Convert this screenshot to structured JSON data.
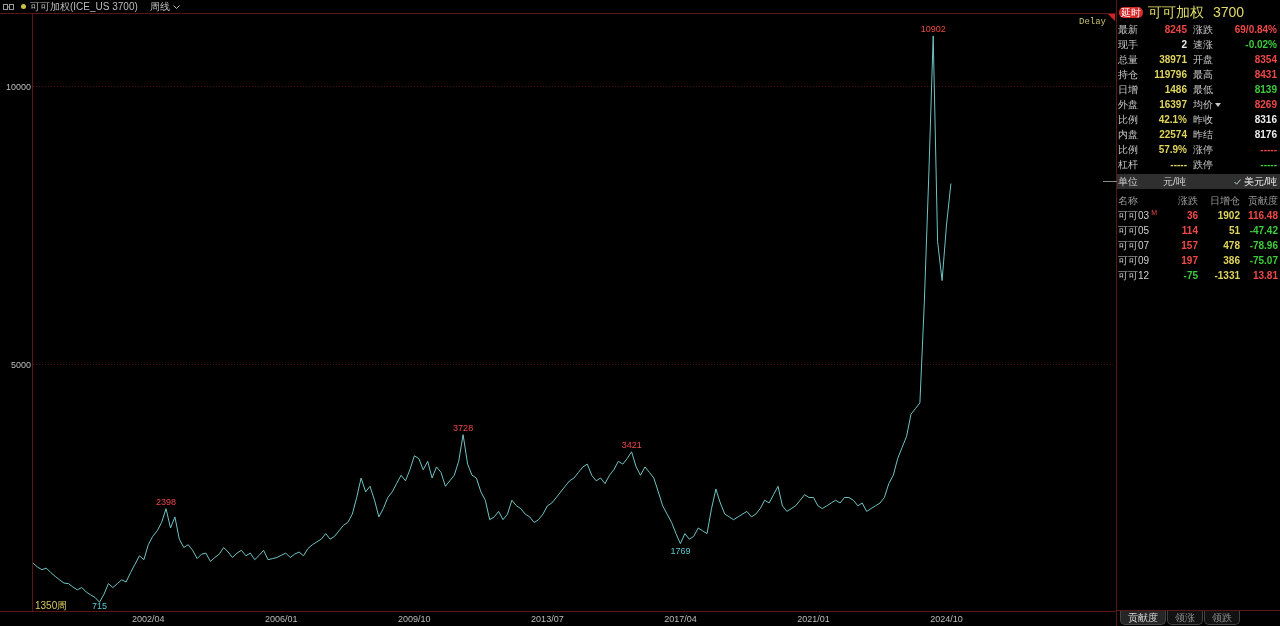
{
  "toolbar": {
    "symbol": "可可加权(ICE_US 3700)",
    "period": "周线"
  },
  "chart": {
    "delay_label": "Delay",
    "bar_count": "1350周",
    "chart_data": {
      "type": "line",
      "categories": [
        null,
        null,
        null,
        null,
        null,
        null,
        null,
        null,
        null,
        null,
        null,
        null,
        null,
        null,
        null,
        null,
        null,
        null,
        null,
        null,
        null,
        null,
        null,
        null,
        null,
        null,
        "2002/04",
        null,
        null,
        null,
        null,
        null,
        null,
        null,
        null,
        null,
        null,
        null,
        null,
        null,
        null,
        null,
        null,
        null,
        null,
        null,
        null,
        null,
        null,
        null,
        null,
        null,
        null,
        null,
        null,
        null,
        "2006/01",
        null,
        null,
        null,
        null,
        null,
        null,
        null,
        null,
        null,
        null,
        null,
        null,
        null,
        null,
        null,
        null,
        null,
        null,
        null,
        null,
        null,
        null,
        null,
        null,
        null,
        null,
        null,
        null,
        null,
        "2009/10",
        null,
        null,
        null,
        null,
        null,
        null,
        null,
        null,
        null,
        null,
        null,
        null,
        null,
        null,
        null,
        null,
        null,
        null,
        null,
        null,
        null,
        null,
        null,
        null,
        null,
        null,
        null,
        null,
        null,
        "2013/07",
        null,
        null,
        null,
        null,
        null,
        null,
        null,
        null,
        null,
        null,
        null,
        null,
        null,
        null,
        null,
        null,
        null,
        null,
        null,
        null,
        null,
        null,
        null,
        null,
        null,
        null,
        null,
        null,
        null,
        "2017/04",
        null,
        null,
        null,
        null,
        null,
        null,
        null,
        null,
        null,
        null,
        null,
        null,
        null,
        null,
        null,
        null,
        null,
        null,
        null,
        null,
        null,
        null,
        null,
        null,
        null,
        null,
        null,
        null,
        null,
        "2021/01",
        null,
        null,
        null,
        null,
        null,
        null,
        null,
        null,
        null,
        null,
        null,
        null,
        null,
        null,
        null,
        null,
        null,
        null,
        null,
        null,
        null,
        null,
        null,
        null,
        null,
        null,
        null,
        null,
        null,
        "2024/10",
        null,
        null,
        null,
        null,
        null,
        null,
        null,
        null,
        null,
        null,
        null,
        null,
        null,
        null,
        null,
        null,
        null,
        null,
        null,
        null,
        null,
        null,
        null,
        null,
        null,
        null,
        null,
        null,
        null,
        null,
        null,
        null,
        null,
        null,
        null,
        null,
        null,
        null
      ],
      "series": [
        {
          "color": "#6fc3c3",
          "values": [
            1420,
            1350,
            1300,
            1330,
            1250,
            1180,
            1120,
            1060,
            1050,
            990,
            940,
            980,
            900,
            850,
            800,
            715,
            860,
            1050,
            980,
            1050,
            1120,
            1080,
            1250,
            1400,
            1550,
            1480,
            1750,
            1900,
            2000,
            2150,
            2398,
            2050,
            2250,
            1850,
            1700,
            1750,
            1650,
            1500,
            1580,
            1600,
            1450,
            1520,
            1580,
            1700,
            1620,
            1520,
            1600,
            1650,
            1550,
            1600,
            1480,
            1560,
            1650,
            1480,
            1500,
            1520,
            1560,
            1600,
            1520,
            1580,
            1620,
            1550,
            1680,
            1750,
            1800,
            1850,
            1950,
            1850,
            1900,
            2000,
            2100,
            2150,
            2300,
            2600,
            2950,
            2700,
            2800,
            2550,
            2250,
            2400,
            2600,
            2700,
            2850,
            3000,
            2900,
            3100,
            3350,
            3300,
            3100,
            3250,
            2950,
            3150,
            3050,
            2800,
            2900,
            3000,
            3250,
            3728,
            3200,
            3000,
            2950,
            2700,
            2550,
            2200,
            2250,
            2350,
            2200,
            2300,
            2550,
            2450,
            2400,
            2300,
            2250,
            2150,
            2200,
            2300,
            2450,
            2500,
            2600,
            2700,
            2800,
            2900,
            2950,
            3050,
            3150,
            3200,
            3000,
            2900,
            2950,
            2850,
            3000,
            3100,
            3250,
            3200,
            3300,
            3421,
            3150,
            3000,
            3150,
            3050,
            2950,
            2700,
            2450,
            2300,
            2150,
            1950,
            1769,
            1950,
            1850,
            1900,
            2050,
            2000,
            1950,
            2400,
            2750,
            2500,
            2300,
            2250,
            2200,
            2250,
            2300,
            2350,
            2250,
            2300,
            2400,
            2550,
            2500,
            2650,
            2800,
            2450,
            2350,
            2400,
            2450,
            2550,
            2650,
            2600,
            2600,
            2450,
            2400,
            2450,
            2500,
            2550,
            2500,
            2600,
            2600,
            2550,
            2450,
            2500,
            2350,
            2400,
            2450,
            2500,
            2600,
            2850,
            3000,
            3300,
            3500,
            3700,
            4100,
            4200,
            4300,
            6100,
            8400,
            10902,
            7200,
            6500,
            7500,
            8245,
            null,
            null,
            null,
            null,
            null,
            null,
            null,
            null,
            null,
            null,
            null,
            null,
            null,
            null,
            null,
            null,
            null,
            null,
            null,
            null,
            null,
            null,
            null,
            null,
            null,
            null,
            null,
            null,
            null,
            null,
            null,
            null,
            null,
            null,
            null,
            null,
            null
          ]
        }
      ],
      "ylim": [
        558,
        11313
      ],
      "yticks": [
        5000,
        10000
      ],
      "annotations": [
        {
          "y": 2398,
          "text": "2398"
        },
        {
          "y": 715,
          "text": "715"
        },
        {
          "y": 3728,
          "text": "3728"
        },
        {
          "y": 3421,
          "text": "3421"
        },
        {
          "y": 1769,
          "text": "1769"
        },
        {
          "y": 10902,
          "text": "10902"
        }
      ]
    }
  },
  "quote_panel": {
    "badge": "延时",
    "name": "可可加权",
    "code": "3700",
    "rows": [
      {
        "cells": [
          {
            "text": "最新",
            "kind": "label"
          },
          {
            "text": "8245",
            "kind": "value",
            "color": "#f04848"
          },
          {
            "text": "涨跌",
            "kind": "label"
          },
          {
            "text": "69/0.84%",
            "kind": "value",
            "color": "#f04848"
          }
        ]
      },
      {
        "cells": [
          {
            "text": "现手",
            "kind": "label"
          },
          {
            "text": "2",
            "kind": "value",
            "color": "#ececec"
          },
          {
            "text": "速涨",
            "kind": "label"
          },
          {
            "text": "-0.02%",
            "kind": "value",
            "color": "#3ccc3c"
          }
        ]
      },
      {
        "cells": [
          {
            "text": "总量",
            "kind": "label"
          },
          {
            "text": "38971",
            "kind": "value",
            "color": "#e0d45c"
          },
          {
            "text": "开盘",
            "kind": "label"
          },
          {
            "text": "8354",
            "kind": "value",
            "color": "#f04848"
          }
        ]
      },
      {
        "cells": [
          {
            "text": "持仓",
            "kind": "label"
          },
          {
            "text": "119796",
            "kind": "value",
            "color": "#e0d45c"
          },
          {
            "text": "最高",
            "kind": "label"
          },
          {
            "text": "8431",
            "kind": "value",
            "color": "#f04848"
          }
        ]
      },
      {
        "cells": [
          {
            "text": "日增",
            "kind": "label"
          },
          {
            "text": "1486",
            "kind": "value",
            "color": "#e0d45c"
          },
          {
            "text": "最低",
            "kind": "label"
          },
          {
            "text": "8139",
            "kind": "value",
            "color": "#3ccc3c"
          }
        ]
      },
      {
        "cells": [
          {
            "text": "外盘",
            "kind": "label"
          },
          {
            "text": "16397",
            "kind": "value",
            "color": "#e0d45c"
          },
          {
            "text": "均价",
            "kind": "dropdown"
          },
          {
            "text": "8269",
            "kind": "value",
            "color": "#f04848"
          }
        ]
      },
      {
        "cells": [
          {
            "text": "比例",
            "kind": "label"
          },
          {
            "text": "42.1%",
            "kind": "value",
            "color": "#e0d45c"
          },
          {
            "text": "昨收",
            "kind": "label"
          },
          {
            "text": "8316",
            "kind": "value",
            "color": "#ececec"
          }
        ]
      },
      {
        "cells": [
          {
            "text": "内盘",
            "kind": "label"
          },
          {
            "text": "22574",
            "kind": "value",
            "color": "#e0d45c"
          },
          {
            "text": "昨结",
            "kind": "label"
          },
          {
            "text": "8176",
            "kind": "value",
            "color": "#ececec"
          }
        ]
      },
      {
        "cells": [
          {
            "text": "比例",
            "kind": "label"
          },
          {
            "text": "57.9%",
            "kind": "value",
            "color": "#e0d45c"
          },
          {
            "text": "涨停",
            "kind": "label"
          },
          {
            "text": "-----",
            "kind": "value",
            "color": "#f04848"
          }
        ]
      },
      {
        "cells": [
          {
            "text": "杠杆",
            "kind": "label"
          },
          {
            "text": "-----",
            "kind": "value",
            "color": "#e0d45c"
          },
          {
            "text": "跌停",
            "kind": "label"
          },
          {
            "text": "-----",
            "kind": "value",
            "color": "#3ccc3c"
          }
        ]
      }
    ]
  },
  "units": {
    "label": "单位",
    "options": [
      {
        "label": "元/吨",
        "selected": false
      },
      {
        "label": "美元/吨",
        "selected": true
      }
    ]
  },
  "contracts": {
    "columns": [
      "名称",
      "涨跌",
      "日增仓",
      "贡献度"
    ],
    "rows": [
      {
        "cells": [
          {
            "text": "可可03",
            "tag": "M"
          },
          {
            "text": "36",
            "color": "#f04848"
          },
          {
            "text": "1902",
            "color": "#e0d45c"
          },
          {
            "text": "116.48",
            "color": "#f04848"
          }
        ]
      },
      {
        "cells": [
          {
            "text": "可可05"
          },
          {
            "text": "114",
            "color": "#f04848"
          },
          {
            "text": "51",
            "color": "#e0d45c"
          },
          {
            "text": "-47.42",
            "color": "#3ccc3c"
          }
        ]
      },
      {
        "cells": [
          {
            "text": "可可07"
          },
          {
            "text": "157",
            "color": "#f04848"
          },
          {
            "text": "478",
            "color": "#e0d45c"
          },
          {
            "text": "-78.96",
            "color": "#3ccc3c"
          }
        ]
      },
      {
        "cells": [
          {
            "text": "可可09"
          },
          {
            "text": "197",
            "color": "#f04848"
          },
          {
            "text": "386",
            "color": "#e0d45c"
          },
          {
            "text": "-75.07",
            "color": "#3ccc3c"
          }
        ]
      },
      {
        "cells": [
          {
            "text": "可可12"
          },
          {
            "text": "-75",
            "color": "#3ccc3c"
          },
          {
            "text": "-1331",
            "color": "#e0d45c"
          },
          {
            "text": "13.81",
            "color": "#f04848"
          }
        ]
      }
    ]
  },
  "bottom_tabs": [
    {
      "label": "贡献度",
      "selected": true
    },
    {
      "label": "领涨",
      "selected": false
    },
    {
      "label": "领跌",
      "selected": false
    }
  ]
}
